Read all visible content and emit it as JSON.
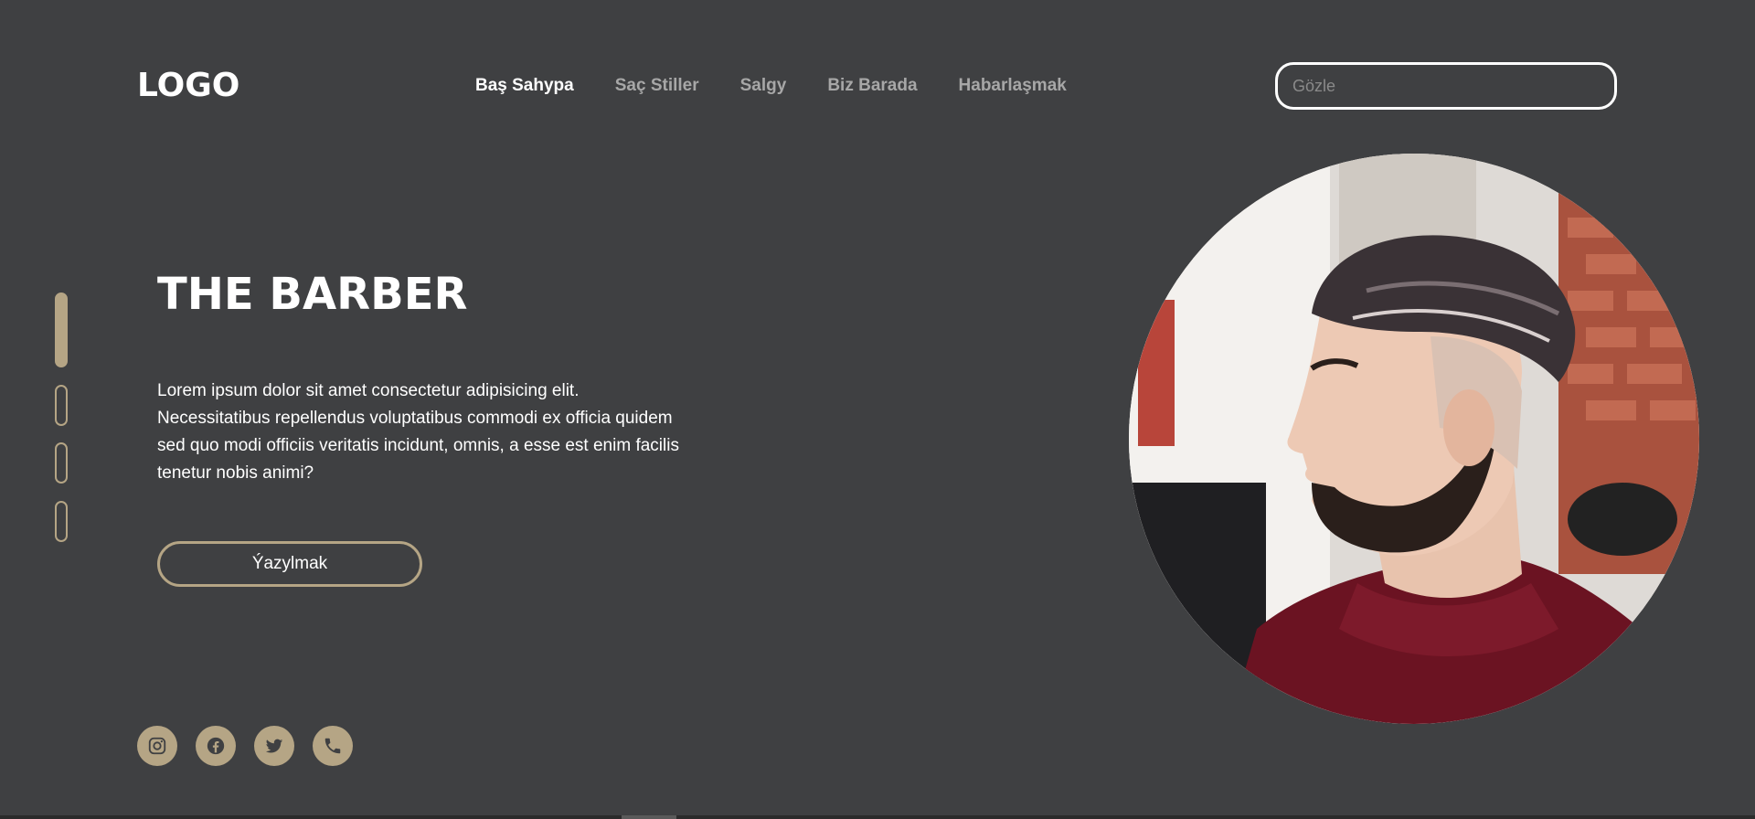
{
  "header": {
    "logo": "LOGO",
    "nav": [
      {
        "label": "Baş Sahypa",
        "active": true
      },
      {
        "label": "Saç Stiller",
        "active": false
      },
      {
        "label": "Salgy",
        "active": false
      },
      {
        "label": "Biz Barada",
        "active": false
      },
      {
        "label": "Habarlaşmak",
        "active": false
      }
    ],
    "search_placeholder": "Gözle"
  },
  "hero": {
    "title": "THE BARBER",
    "text": "Lorem ipsum dolor sit amet consectetur adipisicing elit. Necessitatibus repellendus voluptatibus commodi ex officia quidem sed quo modi officiis veritatis incidunt, omnis, a esse est enim facilis tenetur nobis animi?",
    "button": "Ýazylmak"
  },
  "slider": {
    "count": 4,
    "active_index": 0
  },
  "socials": [
    {
      "icon": "instagram-icon"
    },
    {
      "icon": "facebook-icon"
    },
    {
      "icon": "twitter-icon"
    },
    {
      "icon": "phone-icon"
    }
  ],
  "colors": {
    "background": "#3f4042",
    "accent": "#b5a585",
    "nav_inactive": "#a7a7a7",
    "text": "#ffffff"
  }
}
